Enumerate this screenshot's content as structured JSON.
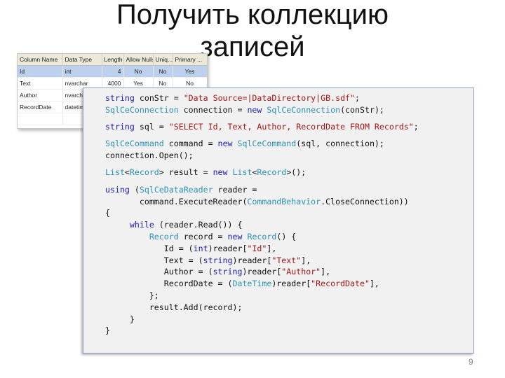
{
  "slide": {
    "title_line1": "Получить коллекцию",
    "title_line2": "записей",
    "page_number": "9"
  },
  "schema_table": {
    "headers": [
      "Column Name",
      "Data Type",
      "Length",
      "Allow Nulls",
      "Uniq...",
      "Primary ..."
    ],
    "rows": [
      [
        "Id",
        "int",
        "4",
        "No",
        "No",
        "Yes"
      ],
      [
        "Text",
        "nvarchar",
        "4000",
        "Yes",
        "No",
        "No"
      ],
      [
        "Author",
        "nvarchar",
        "",
        "",
        "",
        ""
      ],
      [
        "RecordDate",
        "datetime",
        "",
        "",
        "",
        ""
      ],
      [
        "",
        "",
        "",
        "",
        "",
        ""
      ]
    ],
    "selected_row": 0
  },
  "code": {
    "lines": [
      [
        {
          "t": "string",
          "c": "kw"
        },
        {
          "t": " conStr = "
        },
        {
          "t": "\"Data Source=|DataDirectory|GB.sdf\"",
          "c": "st"
        },
        {
          "t": ";"
        }
      ],
      [
        {
          "t": "SqlCeConnection",
          "c": "ty"
        },
        {
          "t": " connection = "
        },
        {
          "t": "new",
          "c": "kw"
        },
        {
          "t": " "
        },
        {
          "t": "SqlCeConnection",
          "c": "ty"
        },
        {
          "t": "(conStr);"
        }
      ],
      "gap",
      [
        {
          "t": "string",
          "c": "kw"
        },
        {
          "t": " sql = "
        },
        {
          "t": "\"SELECT Id, Text, Author, RecordDate FROM Records\"",
          "c": "st"
        },
        {
          "t": ";"
        }
      ],
      "gap",
      [
        {
          "t": "SqlCeCommand",
          "c": "ty"
        },
        {
          "t": " command = "
        },
        {
          "t": "new",
          "c": "kw"
        },
        {
          "t": " "
        },
        {
          "t": "SqlCeCommand",
          "c": "ty"
        },
        {
          "t": "(sql, connection);"
        }
      ],
      [
        {
          "t": "connection.Open();"
        }
      ],
      "gap",
      [
        {
          "t": "List",
          "c": "ty"
        },
        {
          "t": "<"
        },
        {
          "t": "Record",
          "c": "ty"
        },
        {
          "t": "> result = "
        },
        {
          "t": "new",
          "c": "kw"
        },
        {
          "t": " "
        },
        {
          "t": "List",
          "c": "ty"
        },
        {
          "t": "<"
        },
        {
          "t": "Record",
          "c": "ty"
        },
        {
          "t": ">();"
        }
      ],
      "gap",
      [
        {
          "t": "using",
          "c": "kw"
        },
        {
          "t": " ("
        },
        {
          "t": "SqlCeDataReader",
          "c": "ty"
        },
        {
          "t": " reader ="
        }
      ],
      [
        {
          "t": "       command.ExecuteReader("
        },
        {
          "t": "CommandBehavior",
          "c": "ty"
        },
        {
          "t": ".CloseConnection))"
        }
      ],
      [
        {
          "t": "{"
        }
      ],
      [
        {
          "t": "     "
        },
        {
          "t": "while",
          "c": "kw"
        },
        {
          "t": " (reader.Read()) {"
        }
      ],
      [
        {
          "t": "         "
        },
        {
          "t": "Record",
          "c": "ty"
        },
        {
          "t": " record = "
        },
        {
          "t": "new",
          "c": "kw"
        },
        {
          "t": " "
        },
        {
          "t": "Record",
          "c": "ty"
        },
        {
          "t": "() {"
        }
      ],
      [
        {
          "t": "            Id = ("
        },
        {
          "t": "int",
          "c": "kw"
        },
        {
          "t": ")reader["
        },
        {
          "t": "\"Id\"",
          "c": "st"
        },
        {
          "t": "],"
        }
      ],
      [
        {
          "t": "            Text = ("
        },
        {
          "t": "string",
          "c": "kw"
        },
        {
          "t": ")reader["
        },
        {
          "t": "\"Text\"",
          "c": "st"
        },
        {
          "t": "],"
        }
      ],
      [
        {
          "t": "            Author = ("
        },
        {
          "t": "string",
          "c": "kw"
        },
        {
          "t": ")reader["
        },
        {
          "t": "\"Author\"",
          "c": "st"
        },
        {
          "t": "],"
        }
      ],
      [
        {
          "t": "            RecordDate = ("
        },
        {
          "t": "DateTime",
          "c": "ty"
        },
        {
          "t": ")reader["
        },
        {
          "t": "\"RecordDate\"",
          "c": "st"
        },
        {
          "t": "],"
        }
      ],
      [
        {
          "t": "         };"
        }
      ],
      [
        {
          "t": "         result.Add(record);"
        }
      ],
      [
        {
          "t": "     }"
        }
      ],
      [
        {
          "t": "}"
        }
      ]
    ]
  },
  "colors": {
    "keyword": "#1a1ab0",
    "type": "#2b91af",
    "string": "#a31515",
    "code_background": "#f1f1f1",
    "selected_row": "#bdd0ee"
  }
}
